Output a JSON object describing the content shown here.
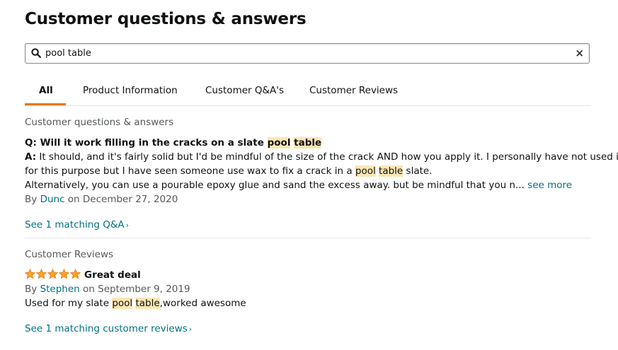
{
  "page_title": "Customer questions & answers",
  "search": {
    "value": "pool table",
    "clear_label": "×"
  },
  "tabs": [
    {
      "label": "All",
      "active": true
    },
    {
      "label": "Product Information",
      "active": false
    },
    {
      "label": "Customer Q&A's",
      "active": false
    },
    {
      "label": "Customer Reviews",
      "active": false
    }
  ],
  "qa_section": {
    "title": "Customer questions & answers",
    "question": {
      "prefix": "Q:",
      "text_before": "Will it work filling in the cracks on a slate",
      "highlight_1": "pool",
      "highlight_2": "table"
    },
    "answer": {
      "prefix": "A:",
      "line1": "It should, and it's fairly solid but I'd be mindful of the size of the crack AND how you apply it. I personally have not used it",
      "line2_before": "for this purpose but I have seen someone use wax to fix a crack in a",
      "highlight_1": "pool",
      "highlight_2": "table",
      "line2_after": "slate.",
      "line3": "Alternatively, you can use a pourable epoxy glue and sand the excess away. but be mindful that you n...",
      "see_more": "see more"
    },
    "byline": {
      "by": "By",
      "author": "Dunc",
      "date": "on December 27, 2020"
    },
    "see_matching": "See 1 matching Q&A"
  },
  "reviews_section": {
    "title": "Customer Reviews",
    "rating": 5,
    "review_title": "Great deal",
    "byline": {
      "by": "By",
      "author": "Stephen",
      "date": "on September 9, 2019"
    },
    "body_before": "Used for my slate",
    "highlight_1": "pool",
    "highlight_2": "table",
    "body_after": ",worked awesome",
    "see_matching": "See 1 matching customer reviews"
  },
  "colors": {
    "link": "#007185",
    "tab_underline": "#e77600",
    "highlight": "#fbe6b3",
    "star": "#ffa41c"
  }
}
